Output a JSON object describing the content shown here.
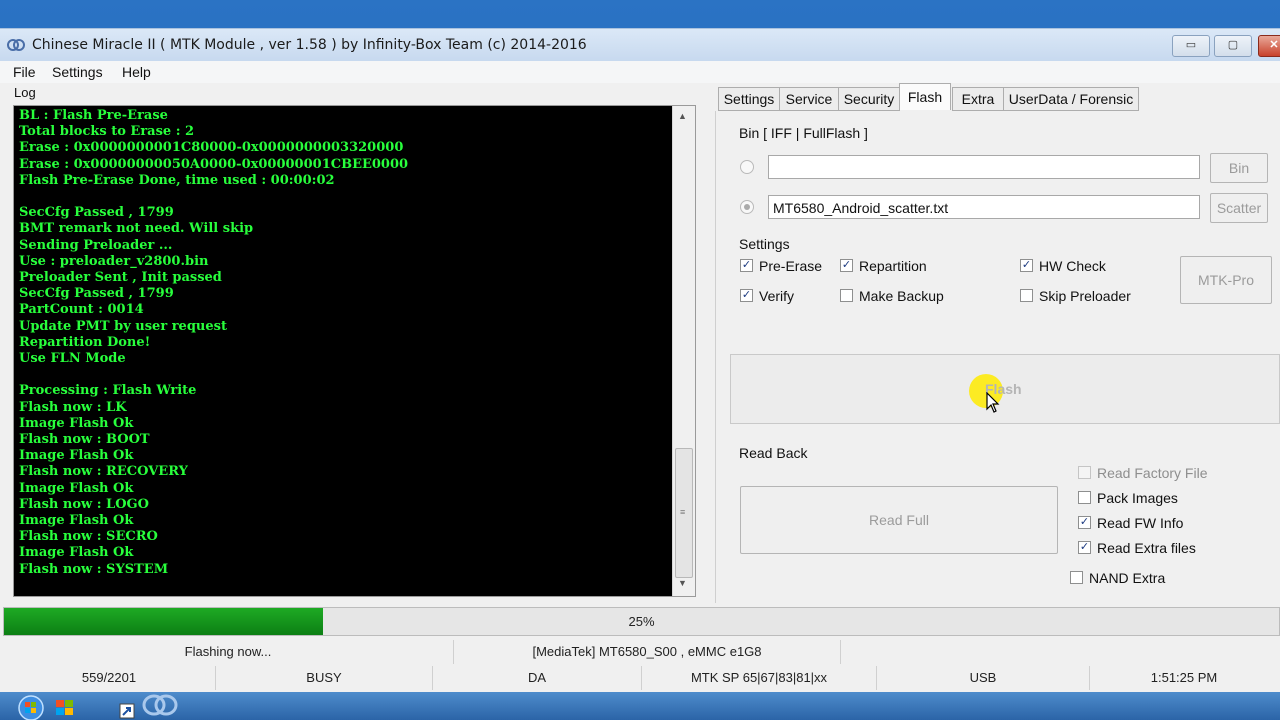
{
  "window": {
    "title": "Chinese Miracle II ( MTK Module , ver 1.58 ) by Infinity-Box Team (c) 2014-2016",
    "min_glyph": "▭",
    "max_glyph": "▢",
    "close_glyph": "✕"
  },
  "menu": [
    "File",
    "Settings",
    "Help"
  ],
  "log": {
    "label": "Log",
    "lines": "BL : Flash Pre-Erase\nTotal blocks to Erase : 2\nErase : 0x0000000001C80000-0x0000000003320000\nErase : 0x00000000050A0000-0x00000001CBEE0000\nFlash Pre-Erase Done, time used : 00:00:02\n\nSecCfg Passed , 1799\nBMT remark not need. Will skip\nSending Preloader ...\nUse : preloader_v2800.bin\nPreloader Sent , Init passed\nSecCfg Passed , 1799\nPartCount : 0014\nUpdate PMT by user request\nRepartition Done!\nUse FLN Mode\n\nProcessing : Flash Write\nFlash now : LK\nImage Flash Ok\nFlash now : BOOT\nImage Flash Ok\nFlash now : RECOVERY\nImage Flash Ok\nFlash now : LOGO\nImage Flash Ok\nFlash now : SECRO\nImage Flash Ok\nFlash now : SYSTEM",
    "up_glyph": "▲",
    "down_glyph": "▼",
    "grip_glyph": "≡"
  },
  "tabs": [
    "Settings",
    "Service",
    "Security",
    "Flash",
    "Extra",
    "UserData / Forensic"
  ],
  "active_tab": "Flash",
  "bin": {
    "title": "Bin  [ IFF | FullFlash ]",
    "bin_value": "",
    "bin_button": "Bin",
    "scatter_value": "MT6580_Android_scatter.txt",
    "scatter_button": "Scatter"
  },
  "settings": {
    "title": "Settings",
    "pre_erase": "Pre-Erase",
    "repartition": "Repartition",
    "hw_check": "HW Check",
    "verify": "Verify",
    "make_backup": "Make Backup",
    "skip_preloader": "Skip Preloader",
    "mtk_pro_button": "MTK-Pro",
    "check_glyph": "✓"
  },
  "flash_button": "Flash",
  "read_back": {
    "title": "Read Back",
    "read_full_button": "Read Full",
    "read_factory_file": "Read Factory File",
    "pack_images": "Pack Images",
    "read_fw_info": "Read FW Info",
    "read_extra_files": "Read Extra files",
    "nand_extra": "NAND Extra"
  },
  "progress": {
    "text": "25%",
    "value": 0.25,
    "color": "#119a1a"
  },
  "status1": {
    "message": "Flashing now...",
    "device": "[MediaTek] MT6580_S00 , eMMC e1G8"
  },
  "status2": {
    "count": "559/2201",
    "state": "BUSY",
    "mode": "DA",
    "sp": "MTK SP 65|67|83|81|xx",
    "port": "USB",
    "time": "1:51:25 PM"
  },
  "colors": {
    "log_text": "#28ff3c",
    "log_bg": "#000000"
  }
}
